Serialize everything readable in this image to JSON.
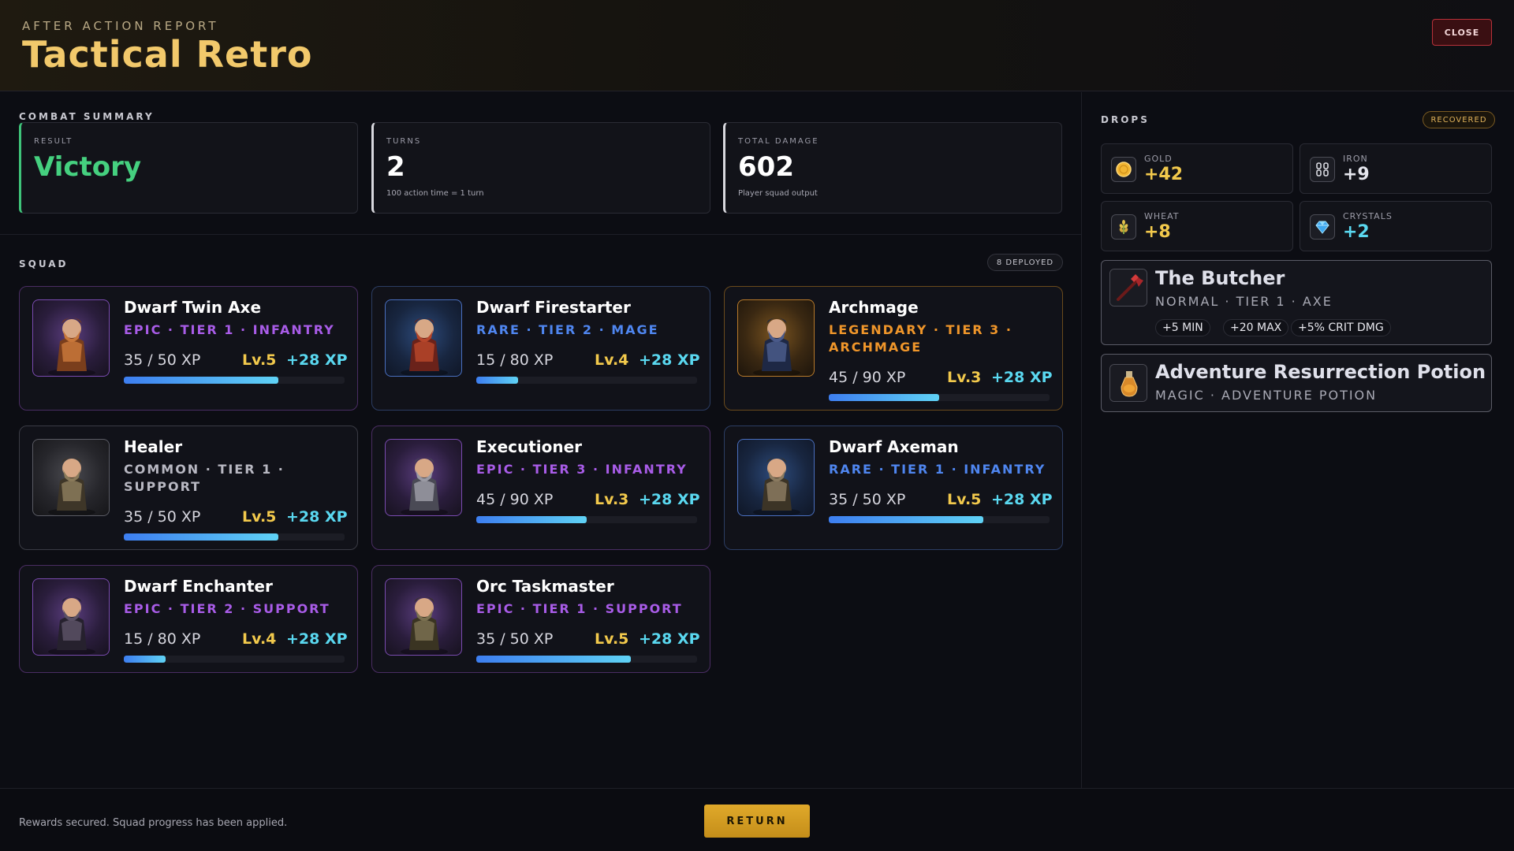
{
  "header": {
    "eyebrow": "AFTER ACTION REPORT",
    "title": "Tactical Retro",
    "close_label": "CLOSE"
  },
  "summary": {
    "section_label": "COMBAT SUMMARY",
    "result": {
      "label": "RESULT",
      "value": "Victory"
    },
    "turns": {
      "label": "TURNS",
      "value": "2",
      "sub": "100 action time = 1 turn"
    },
    "damage": {
      "label": "TOTAL DAMAGE",
      "value": "602",
      "sub": "Player squad output"
    }
  },
  "squad": {
    "section_label": "SQUAD",
    "deployed_badge": "8 DEPLOYED",
    "units": [
      {
        "name": "Dwarf Twin Axe",
        "meta": "EPIC · TIER 1 · INFANTRY",
        "rarity": "epic",
        "xp": "35 / 50 XP",
        "level": "Lv.5",
        "gain": "+28 XP",
        "progress": 0.7,
        "icon": "dwarf-twin-axe-portrait"
      },
      {
        "name": "Dwarf Firestarter",
        "meta": "RARE · TIER 2 · MAGE",
        "rarity": "rare",
        "xp": "15 / 80 XP",
        "level": "Lv.4",
        "gain": "+28 XP",
        "progress": 0.19,
        "icon": "dwarf-firestarter-portrait"
      },
      {
        "name": "Archmage",
        "meta": "LEGENDARY · TIER 3 · ARCHMAGE",
        "rarity": "legendary",
        "xp": "45 / 90 XP",
        "level": "Lv.3",
        "gain": "+28 XP",
        "progress": 0.5,
        "icon": "archmage-portrait"
      },
      {
        "name": "Healer",
        "meta": "COMMON · TIER 1 · SUPPORT",
        "rarity": "common",
        "xp": "35 / 50 XP",
        "level": "Lv.5",
        "gain": "+28 XP",
        "progress": 0.7,
        "icon": "healer-portrait"
      },
      {
        "name": "Executioner",
        "meta": "EPIC · TIER 3 · INFANTRY",
        "rarity": "epic",
        "xp": "45 / 90 XP",
        "level": "Lv.3",
        "gain": "+28 XP",
        "progress": 0.5,
        "icon": "executioner-portrait"
      },
      {
        "name": "Dwarf Axeman",
        "meta": "RARE · TIER 1 · INFANTRY",
        "rarity": "rare",
        "xp": "35 / 50 XP",
        "level": "Lv.5",
        "gain": "+28 XP",
        "progress": 0.7,
        "icon": "dwarf-axeman-portrait"
      },
      {
        "name": "Dwarf Enchanter",
        "meta": "EPIC · TIER 2 · SUPPORT",
        "rarity": "epic",
        "xp": "15 / 80 XP",
        "level": "Lv.4",
        "gain": "+28 XP",
        "progress": 0.19,
        "icon": "dwarf-enchanter-portrait"
      },
      {
        "name": "Orc Taskmaster",
        "meta": "EPIC · TIER 1 · SUPPORT",
        "rarity": "epic",
        "xp": "35 / 50 XP",
        "level": "Lv.5",
        "gain": "+28 XP",
        "progress": 0.7,
        "icon": "orc-taskmaster-portrait"
      }
    ]
  },
  "drops": {
    "section_label": "DROPS",
    "recovered_badge": "RECOVERED",
    "resources": [
      {
        "label": "GOLD",
        "value": "+42",
        "color": "#f2c94c",
        "icon": "gold-coin-icon"
      },
      {
        "label": "IRON",
        "value": "+9",
        "color": "#e6e7ee",
        "icon": "iron-chain-icon"
      },
      {
        "label": "WHEAT",
        "value": "+8",
        "color": "#f2c94c",
        "icon": "wheat-icon"
      },
      {
        "label": "CRYSTALS",
        "value": "+2",
        "color": "#5ad8f0",
        "icon": "crystal-icon"
      }
    ],
    "items": [
      {
        "name": "The Butcher",
        "meta": "NORMAL · TIER 1 · AXE",
        "tags": [
          "+5 MIN",
          "+20 MAX",
          "+5% CRIT DMG"
        ],
        "icon": "axe-icon"
      },
      {
        "name": "Adventure Resurrection Potion",
        "meta": "MAGIC · ADVENTURE POTION",
        "tags": [],
        "icon": "potion-icon"
      }
    ]
  },
  "footer": {
    "message": "Rewards secured. Squad progress has been applied.",
    "return_label": "RETURN"
  }
}
